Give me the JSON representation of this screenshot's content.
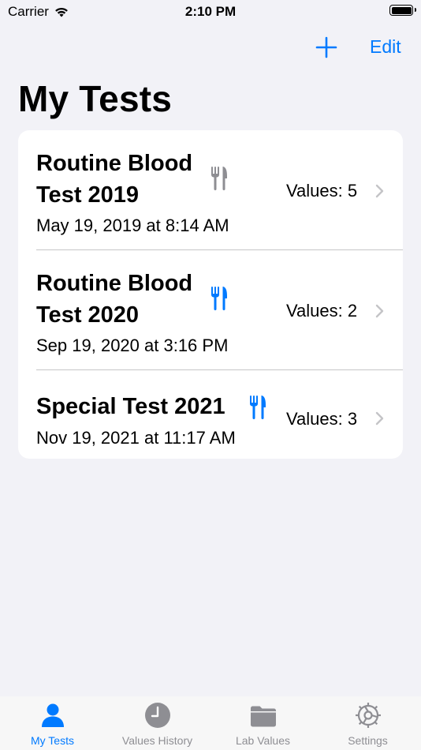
{
  "status_bar": {
    "carrier": "Carrier",
    "time": "2:10 PM"
  },
  "nav": {
    "edit_label": "Edit"
  },
  "page_title": "My Tests",
  "tests": [
    {
      "title": "Routine Blood Test 2019",
      "date": "May 19, 2019 at 8:14 AM",
      "values": "Values: 5",
      "fasting_icon": "fork-knife-icon",
      "icon_color": "#8e8e93"
    },
    {
      "title": "Routine Blood Test 2020",
      "date": "Sep 19, 2020 at 3:16 PM",
      "values": "Values: 2",
      "fasting_icon": "fork-knife-icon",
      "icon_color": "#007aff"
    },
    {
      "title": "Special Test 2021",
      "date": "Nov 19, 2021 at 11:17 AM",
      "values": "Values: 3",
      "fasting_icon": "fork-knife-icon",
      "icon_color": "#007aff"
    }
  ],
  "tab_bar": {
    "tabs": [
      {
        "label": "My Tests",
        "icon": "person-icon",
        "active": true
      },
      {
        "label": "Values History",
        "icon": "clock-icon",
        "active": false
      },
      {
        "label": "Lab Values",
        "icon": "folder-icon",
        "active": false
      },
      {
        "label": "Settings",
        "icon": "gear-icon",
        "active": false
      }
    ]
  },
  "colors": {
    "accent": "#007aff",
    "inactive": "#8e8e93",
    "background": "#f2f2f7"
  }
}
